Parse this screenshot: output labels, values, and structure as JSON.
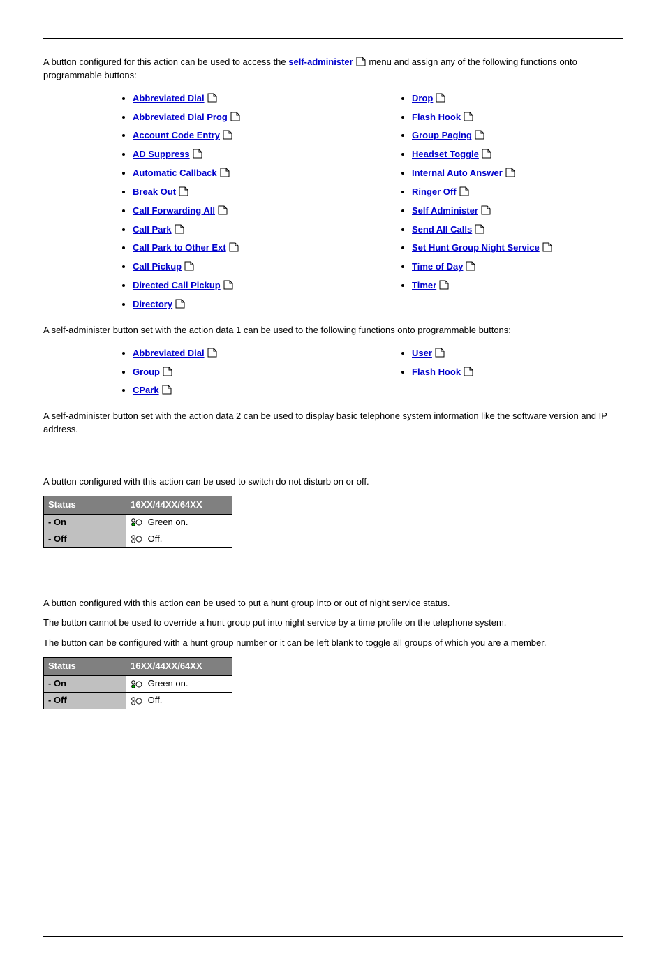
{
  "intro": {
    "before_link": "A button configured for this action can be used to access the ",
    "link_text": "self-administer",
    "after_link": "menu and assign any of the following functions onto programmable buttons:"
  },
  "functions_left": [
    "Abbreviated Dial",
    "Abbreviated Dial Prog",
    "Account Code Entry",
    "AD Suppress",
    "Automatic Callback",
    "Break Out",
    "Call Forwarding All",
    "Call Park",
    "Call Park to Other Ext",
    "Call Pickup",
    "Directed Call Pickup",
    "Directory"
  ],
  "functions_right": [
    "Drop",
    "Flash Hook",
    "Group Paging",
    "Headset Toggle",
    "Internal Auto Answer",
    "Ringer Off",
    "Self Administer",
    "Send All Calls",
    "Set Hunt Group Night Service",
    "Time of Day",
    "Timer"
  ],
  "data1_text": "A self-administer button set with the action data 1 can be used to the following functions onto programmable buttons:",
  "data1_left": [
    "Abbreviated Dial",
    "Group",
    "CPark"
  ],
  "data1_right": [
    "User",
    "Flash Hook"
  ],
  "data2_text": "A self-administer button set with the action data 2 can be used to display basic telephone system information like the software version and IP address.",
  "dnd_text": "A button configured with this action can be used to switch do not disturb on or off.",
  "table_headers": {
    "status": "Status",
    "model": "16XX/44XX/64XX"
  },
  "table_rows": {
    "on_label": "- On",
    "on_val": "Green on.",
    "off_label": "- Off",
    "off_val": "Off."
  },
  "ns_p1": "A button configured with this action can be used to put a hunt group into or out of night service status.",
  "ns_p2": "The button cannot be used to override a hunt group put into night service by a time profile on the telephone system.",
  "ns_p3": "The button can be configured with a hunt group number or it can be left blank to toggle all groups of which you are a member."
}
